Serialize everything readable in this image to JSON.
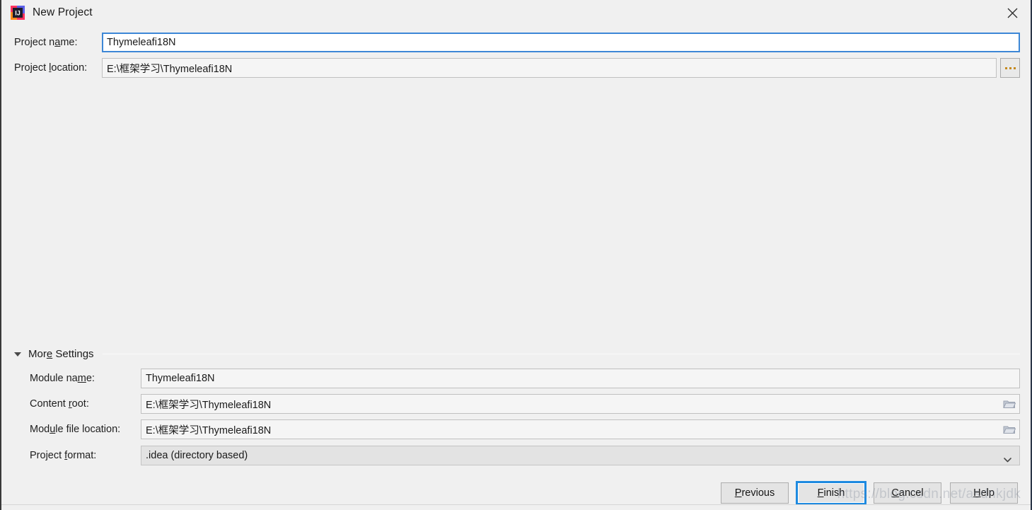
{
  "window": {
    "title": "New Project",
    "app_icon": "intellij-idea-icon",
    "close_icon": "close-icon"
  },
  "form": {
    "project_name": {
      "label_prefix": "Project n",
      "label_mnemonic": "a",
      "label_suffix": "me:",
      "value": "Thymeleafi18N"
    },
    "project_location": {
      "label_prefix": "Project ",
      "label_mnemonic": "l",
      "label_suffix": "ocation:",
      "value": "E:\\框架学习\\Thymeleafi18N",
      "browse_button": "browse-ellipsis-button"
    }
  },
  "more_settings": {
    "label_prefix": "Mor",
    "label_mnemonic": "e",
    "label_suffix": " Settings",
    "expanded": true,
    "expand_icon": "triangle-down-icon",
    "fields": [
      {
        "name": "module-name",
        "label_prefix": "Module na",
        "label_mnemonic": "m",
        "label_suffix": "e:",
        "value": "Thymeleafi18N",
        "trailing_icon": "",
        "style": "plain"
      },
      {
        "name": "content-root",
        "label_prefix": "Content ",
        "label_mnemonic": "r",
        "label_suffix": "oot:",
        "value": "E:\\框架学习\\Thymeleafi18N",
        "trailing_icon": "folder-icon",
        "style": "plain"
      },
      {
        "name": "module-file-location",
        "label_prefix": "Mod",
        "label_mnemonic": "u",
        "label_suffix": "le file location:",
        "value": "E:\\框架学习\\Thymeleafi18N",
        "trailing_icon": "folder-icon",
        "style": "plain"
      },
      {
        "name": "project-format",
        "label_prefix": "Project ",
        "label_mnemonic": "f",
        "label_suffix": "ormat:",
        "value": ".idea (directory based)",
        "trailing_icon": "chevron-down-icon",
        "style": "combo"
      }
    ],
    "project_format_options": [
      ".idea (directory based)"
    ]
  },
  "buttons": [
    {
      "name": "previous-button",
      "prefix": "",
      "mnemonic": "P",
      "suffix": "revious",
      "default": false
    },
    {
      "name": "finish-button",
      "prefix": "",
      "mnemonic": "F",
      "suffix": "inish",
      "default": true
    },
    {
      "name": "cancel-button",
      "prefix": "",
      "mnemonic": "C",
      "suffix": "ancel",
      "default": false
    },
    {
      "name": "help-button",
      "prefix": "",
      "mnemonic": "H",
      "suffix": "elp",
      "default": false
    }
  ],
  "watermark": {
    "text": "https://blog.csdn.net/asdnkjdk"
  },
  "colors": {
    "dialog_bg": "#f0f0f0",
    "field_bg": "#ffffff",
    "focus_blue": "#3d87d6",
    "default_button_ring": "#1e8ae0",
    "combo_bg": "#e3e3e3",
    "text": "#1a1a1a"
  }
}
